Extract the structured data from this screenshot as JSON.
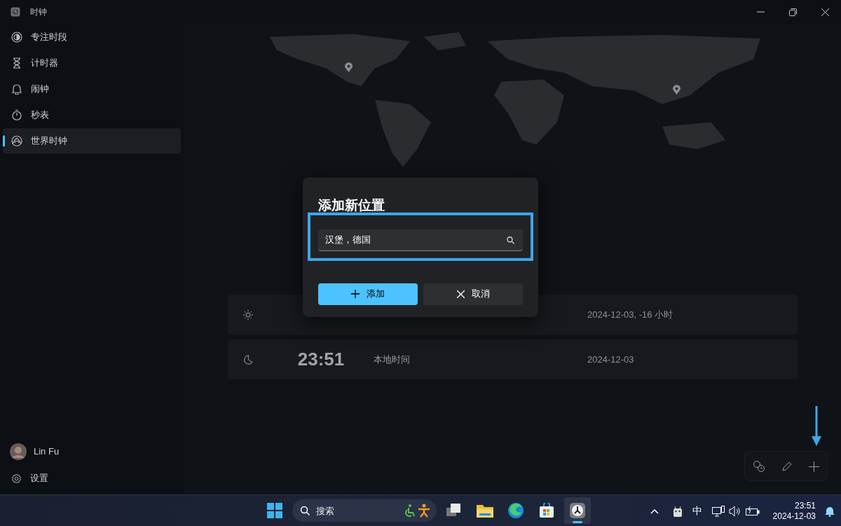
{
  "window": {
    "title": "时钟"
  },
  "sidebar": {
    "items": [
      {
        "label": "专注时段",
        "selected": false
      },
      {
        "label": "计时器",
        "selected": false
      },
      {
        "label": "闹钟",
        "selected": false
      },
      {
        "label": "秒表",
        "selected": false
      },
      {
        "label": "世界时钟",
        "selected": true
      }
    ],
    "user": {
      "name": "Lin Fu"
    },
    "settings": {
      "label": "设置"
    }
  },
  "clocks": [
    {
      "kind": "day",
      "date": "2024-12-03, -16 小时"
    },
    {
      "kind": "night",
      "time": "23:51",
      "place": "本地时间",
      "date": "2024-12-03"
    }
  ],
  "dialog": {
    "title": "添加新位置",
    "search": {
      "value": "汉堡，德国"
    },
    "buttons": [
      {
        "label": "添加",
        "kind": "primary"
      },
      {
        "label": "取消",
        "kind": "secondary"
      }
    ]
  },
  "taskbar": {
    "search": {
      "placeholder": "搜索"
    },
    "tray": {
      "ime": "中",
      "time": "23:51",
      "date": "2024-12-03"
    }
  }
}
